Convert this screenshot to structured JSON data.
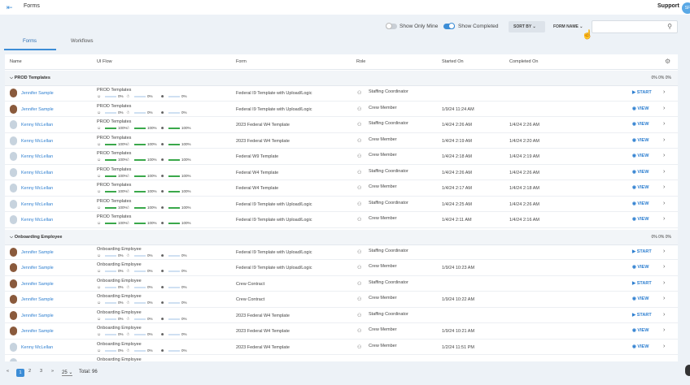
{
  "topbar": {
    "title": "Forms",
    "support": "Support",
    "avatar": "SF"
  },
  "toolbar": {
    "show_only_mine": "Show Only Mine",
    "show_completed": "Show Completed",
    "sort_by": "SORT BY",
    "form_name": "FORM NAME",
    "search_placeholder": ""
  },
  "tabs": [
    {
      "label": "Forms",
      "active": true
    },
    {
      "label": "Workflows",
      "active": false
    }
  ],
  "columns": [
    "Name",
    "UI Flow",
    "Form",
    "Role",
    "Started On",
    "Completed On"
  ],
  "groups": [
    {
      "title": "PROD Templates",
      "stats": "0% 0% 0%"
    },
    {
      "title": "Onboarding Employee",
      "stats": "0% 0% 0%"
    }
  ],
  "rows": [
    {
      "avatar": "j",
      "name": "Jennifer Sample",
      "flow": "PROD Templates",
      "p1": "0%",
      "p2": "0%",
      "p3": "0%",
      "full": false,
      "form": "Federal I9 Template with Upload/Logic",
      "role": "Staffing Coordinator",
      "started": "",
      "completed": "",
      "action": "START"
    },
    {
      "avatar": "j",
      "name": "Jennifer Sample",
      "flow": "PROD Templates",
      "p1": "0%",
      "p2": "0%",
      "p3": "0%",
      "full": false,
      "form": "Federal I9 Template with Upload/Logic",
      "role": "Crew Member",
      "started": "1/9/24 11:24 AM",
      "completed": "",
      "action": "VIEW"
    },
    {
      "avatar": "k",
      "name": "Kenny McLellan",
      "flow": "PROD Templates",
      "p1": "100%",
      "p2": "100%",
      "p3": "100%",
      "full": true,
      "form": "2023 Federal W4 Template",
      "role": "Staffing Coordinator",
      "started": "1/4/24 2:26 AM",
      "completed": "1/4/24 2:26 AM",
      "action": "VIEW"
    },
    {
      "avatar": "k",
      "name": "Kenny McLellan",
      "flow": "PROD Templates",
      "p1": "100%",
      "p2": "100%",
      "p3": "100%",
      "full": true,
      "form": "2023 Federal W4 Template",
      "role": "Crew Member",
      "started": "1/4/24 2:19 AM",
      "completed": "1/4/24 2:20 AM",
      "action": "VIEW"
    },
    {
      "avatar": "k",
      "name": "Kenny McLellan",
      "flow": "PROD Templates",
      "p1": "100%",
      "p2": "100%",
      "p3": "100%",
      "full": true,
      "form": "Federal W9 Template",
      "role": "Crew Member",
      "started": "1/4/24 2:18 AM",
      "completed": "1/4/24 2:19 AM",
      "action": "VIEW"
    },
    {
      "avatar": "k",
      "name": "Kenny McLellan",
      "flow": "PROD Templates",
      "p1": "100%",
      "p2": "100%",
      "p3": "100%",
      "full": true,
      "form": "Federal W4 Template",
      "role": "Staffing Coordinator",
      "started": "1/4/24 2:26 AM",
      "completed": "1/4/24 2:26 AM",
      "action": "VIEW"
    },
    {
      "avatar": "k",
      "name": "Kenny McLellan",
      "flow": "PROD Templates",
      "p1": "100%",
      "p2": "100%",
      "p3": "100%",
      "full": true,
      "form": "Federal W4 Template",
      "role": "Crew Member",
      "started": "1/4/24 2:17 AM",
      "completed": "1/4/24 2:18 AM",
      "action": "VIEW"
    },
    {
      "avatar": "k",
      "name": "Kenny McLellan",
      "flow": "PROD Templates",
      "p1": "100%",
      "p2": "100%",
      "p3": "100%",
      "full": true,
      "form": "Federal I9 Template with Upload/Logic",
      "role": "Staffing Coordinator",
      "started": "1/4/24 2:25 AM",
      "completed": "1/4/24 2:26 AM",
      "action": "VIEW"
    },
    {
      "avatar": "k",
      "name": "Kenny McLellan",
      "flow": "PROD Templates",
      "p1": "100%",
      "p2": "100%",
      "p3": "100%",
      "full": true,
      "form": "Federal I9 Template with Upload/Logic",
      "role": "Crew Member",
      "started": "1/4/24 2:11 AM",
      "completed": "1/4/24 2:16 AM",
      "action": "VIEW"
    },
    {
      "avatar": "j",
      "name": "Jennifer Sample",
      "flow": "Onboarding Employee",
      "p1": "0%",
      "p2": "0%",
      "p3": "0%",
      "full": false,
      "form": "Federal I9 Template with Upload/Logic",
      "role": "Staffing Coordinator",
      "started": "",
      "completed": "",
      "action": "START"
    },
    {
      "avatar": "j",
      "name": "Jennifer Sample",
      "flow": "Onboarding Employee",
      "p1": "0%",
      "p2": "0%",
      "p3": "0%",
      "full": false,
      "form": "Federal I9 Template with Upload/Logic",
      "role": "Crew Member",
      "started": "1/9/24 10:23 AM",
      "completed": "",
      "action": "VIEW"
    },
    {
      "avatar": "j",
      "name": "Jennifer Sample",
      "flow": "Onboarding Employee",
      "p1": "0%",
      "p2": "0%",
      "p3": "0%",
      "full": false,
      "form": "Crew Contract",
      "role": "Staffing Coordinator",
      "started": "",
      "completed": "",
      "action": "START"
    },
    {
      "avatar": "j",
      "name": "Jennifer Sample",
      "flow": "Onboarding Employee",
      "p1": "0%",
      "p2": "0%",
      "p3": "0%",
      "full": false,
      "form": "Crew Contract",
      "role": "Crew Member",
      "started": "1/9/24 10:22 AM",
      "completed": "",
      "action": "VIEW"
    },
    {
      "avatar": "j",
      "name": "Jennifer Sample",
      "flow": "Onboarding Employee",
      "p1": "0%",
      "p2": "0%",
      "p3": "0%",
      "full": false,
      "form": "2023 Federal W4 Template",
      "role": "Staffing Coordinator",
      "started": "",
      "completed": "",
      "action": "START"
    },
    {
      "avatar": "j",
      "name": "Jennifer Sample",
      "flow": "Onboarding Employee",
      "p1": "0%",
      "p2": "0%",
      "p3": "0%",
      "full": false,
      "form": "2023 Federal W4 Template",
      "role": "Crew Member",
      "started": "1/9/24 10:21 AM",
      "completed": "",
      "action": "VIEW"
    },
    {
      "avatar": "k",
      "name": "Kenny McLellan",
      "flow": "Onboarding Employee",
      "p1": "0%",
      "p2": "0%",
      "p3": "0%",
      "full": false,
      "form": "2023 Federal W4 Template",
      "role": "Crew Member",
      "started": "1/2/24 11:51 PM",
      "completed": "",
      "action": "VIEW"
    },
    {
      "avatar": "k",
      "name": "",
      "flow": "Onboarding Employee",
      "p1": "",
      "p2": "",
      "p3": "",
      "full": false,
      "form": "",
      "role": "",
      "started": "",
      "completed": "",
      "action": ""
    }
  ],
  "footer": {
    "pages": [
      "1",
      "2",
      "3"
    ],
    "per_page": "25",
    "total": "Total: 96"
  }
}
